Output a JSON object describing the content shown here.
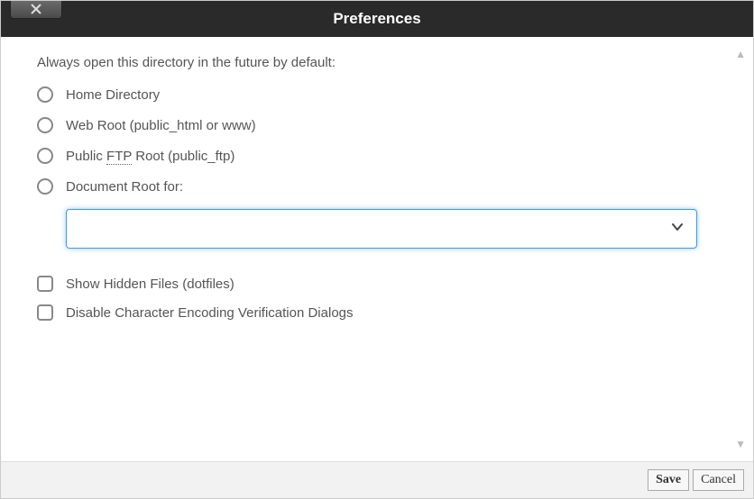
{
  "title": "Preferences",
  "prompt": "Always open this directory in the future by default:",
  "radios": {
    "home": "Home Directory",
    "webroot": "Web Root (public_html or www)",
    "ftp_prefix": "Public ",
    "ftp_abbr": "FTP",
    "ftp_suffix": " Root (public_ftp)",
    "docroot": "Document Root for:"
  },
  "dropdown_value": "",
  "checkboxes": {
    "hidden": "Show Hidden Files (dotfiles)",
    "encoding": "Disable Character Encoding Verification Dialogs"
  },
  "buttons": {
    "save": "Save",
    "cancel": "Cancel"
  }
}
